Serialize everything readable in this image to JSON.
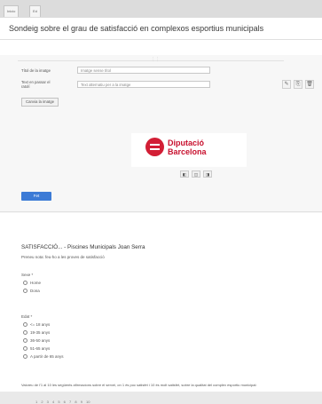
{
  "tabs": [
    "Inicio",
    "Ed"
  ],
  "page_title": "Sondeig sobre el grau de satisfacció en complexos esportius municipals",
  "editor": {
    "label_title": "Títol de la imatge",
    "input_title": "Imatge sense títol",
    "label_alt": "Text en passar el ratolí",
    "input_alt": "Text alternatiu per a la imatge",
    "change_button": "Canvia la imatge",
    "tools": [
      "✎",
      "⎘",
      "🗑"
    ],
    "align": [
      "◧",
      "◫",
      "◨"
    ],
    "done_button": "Fet"
  },
  "logo": {
    "line1": "Diputació",
    "line2": "Barcelona"
  },
  "survey": {
    "title": "SATISFACCIÓ... - Piscines Municipals Joan Serra",
    "subtitle": "Preneu nota: feu-ho a les proves de satisfacció",
    "q_sex": "Sexe *",
    "sex_options": [
      "Home",
      "Dona"
    ],
    "q_age": "Edat *",
    "age_options": [
      "<= 18 anys",
      "19-35 anys",
      "36-50 anys",
      "51-65 anys",
      "A partir de 65 anys"
    ],
    "q_long": "Valoreu de l'1 al 10 les següents afirmacions sobre el servei, on 1 és poc satisfet i 10 és molt satisfet, sobre la qualitat del complex esportiu municipal:",
    "scale": "1  2  3  4  5  6  7  8  9  10"
  }
}
